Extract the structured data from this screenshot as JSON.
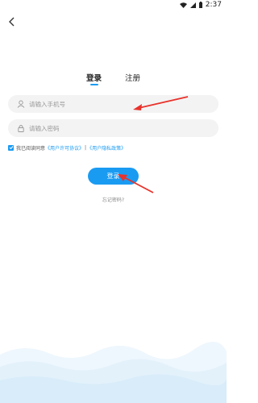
{
  "status_bar": {
    "time": "2:37"
  },
  "tabs": {
    "login": "登录",
    "register": "注册"
  },
  "form": {
    "phone_placeholder": "请输入手机号",
    "password_placeholder": "请输入密码"
  },
  "agreement": {
    "prefix": "我已阅读同意",
    "user_license": "《用户许可协议》",
    "separator": "|",
    "privacy_policy": "《用户隐私政策》",
    "checked": true
  },
  "login_button": "登录",
  "forgot_password": "忘记密码?",
  "colors": {
    "accent": "#1a9bf2",
    "arrow": "#e8322b",
    "wave": "#e6f3fb"
  },
  "icons": [
    "wifi-icon",
    "signal-icon",
    "battery-icon",
    "back-arrow-icon",
    "user-icon",
    "lock-icon",
    "check-icon"
  ]
}
